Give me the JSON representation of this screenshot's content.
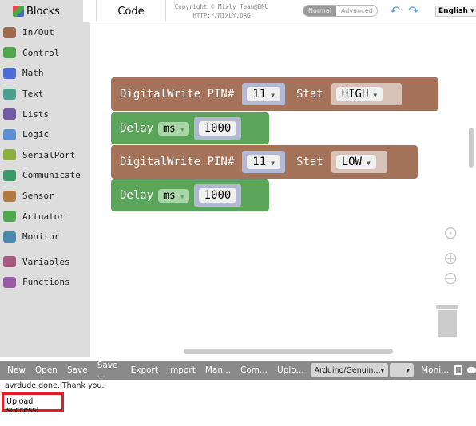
{
  "header": {
    "blocks_tab": "Blocks",
    "code_tab": "Code",
    "copyright": "Copyright © Mixly Team@BNU",
    "url": "HTTP://MIXLY.ORG",
    "mode_normal": "Normal",
    "mode_advanced": "Advanced",
    "language": "English"
  },
  "sidebar": {
    "items": [
      {
        "label": "In/Out",
        "color": "#a0694d"
      },
      {
        "label": "Control",
        "color": "#4fa84f"
      },
      {
        "label": "Math",
        "color": "#4a6cd4"
      },
      {
        "label": "Text",
        "color": "#4aa08c"
      },
      {
        "label": "Lists",
        "color": "#745ba5"
      },
      {
        "label": "Logic",
        "color": "#5b8fd4"
      },
      {
        "label": "SerialPort",
        "color": "#8ab040"
      },
      {
        "label": "Communicate",
        "color": "#3a9a6a"
      },
      {
        "label": "Sensor",
        "color": "#b07a40"
      },
      {
        "label": "Actuator",
        "color": "#4fa84f"
      },
      {
        "label": "Monitor",
        "color": "#4a8ab0"
      },
      {
        "label": "Variables",
        "color": "#a55b80"
      },
      {
        "label": "Functions",
        "color": "#9a5ba5"
      }
    ]
  },
  "blocks": [
    {
      "type": "digitalwrite",
      "label": "DigitalWrite PIN#",
      "pin": "11",
      "stat_label": "Stat",
      "stat": "HIGH"
    },
    {
      "type": "delay",
      "label": "Delay",
      "unit": "ms",
      "value": "1000"
    },
    {
      "type": "digitalwrite",
      "label": "DigitalWrite PIN#",
      "pin": "11",
      "stat_label": "Stat",
      "stat": "LOW"
    },
    {
      "type": "delay",
      "label": "Delay",
      "unit": "ms",
      "value": "1000"
    }
  ],
  "toolbar": {
    "buttons": [
      "New",
      "Open",
      "Save",
      "Save ...",
      "Export",
      "Import",
      "Man...",
      "Com...",
      "Uplo..."
    ],
    "board": "Arduino/Genuin...",
    "port": "",
    "monitor": "Moni..."
  },
  "output": {
    "line1": "avrdude done.  Thank you.",
    "line2": "Upload success!"
  },
  "colors": {
    "digitalwrite": "#a5725a",
    "delay": "#5ba55b",
    "highlight": "#e21b24"
  }
}
